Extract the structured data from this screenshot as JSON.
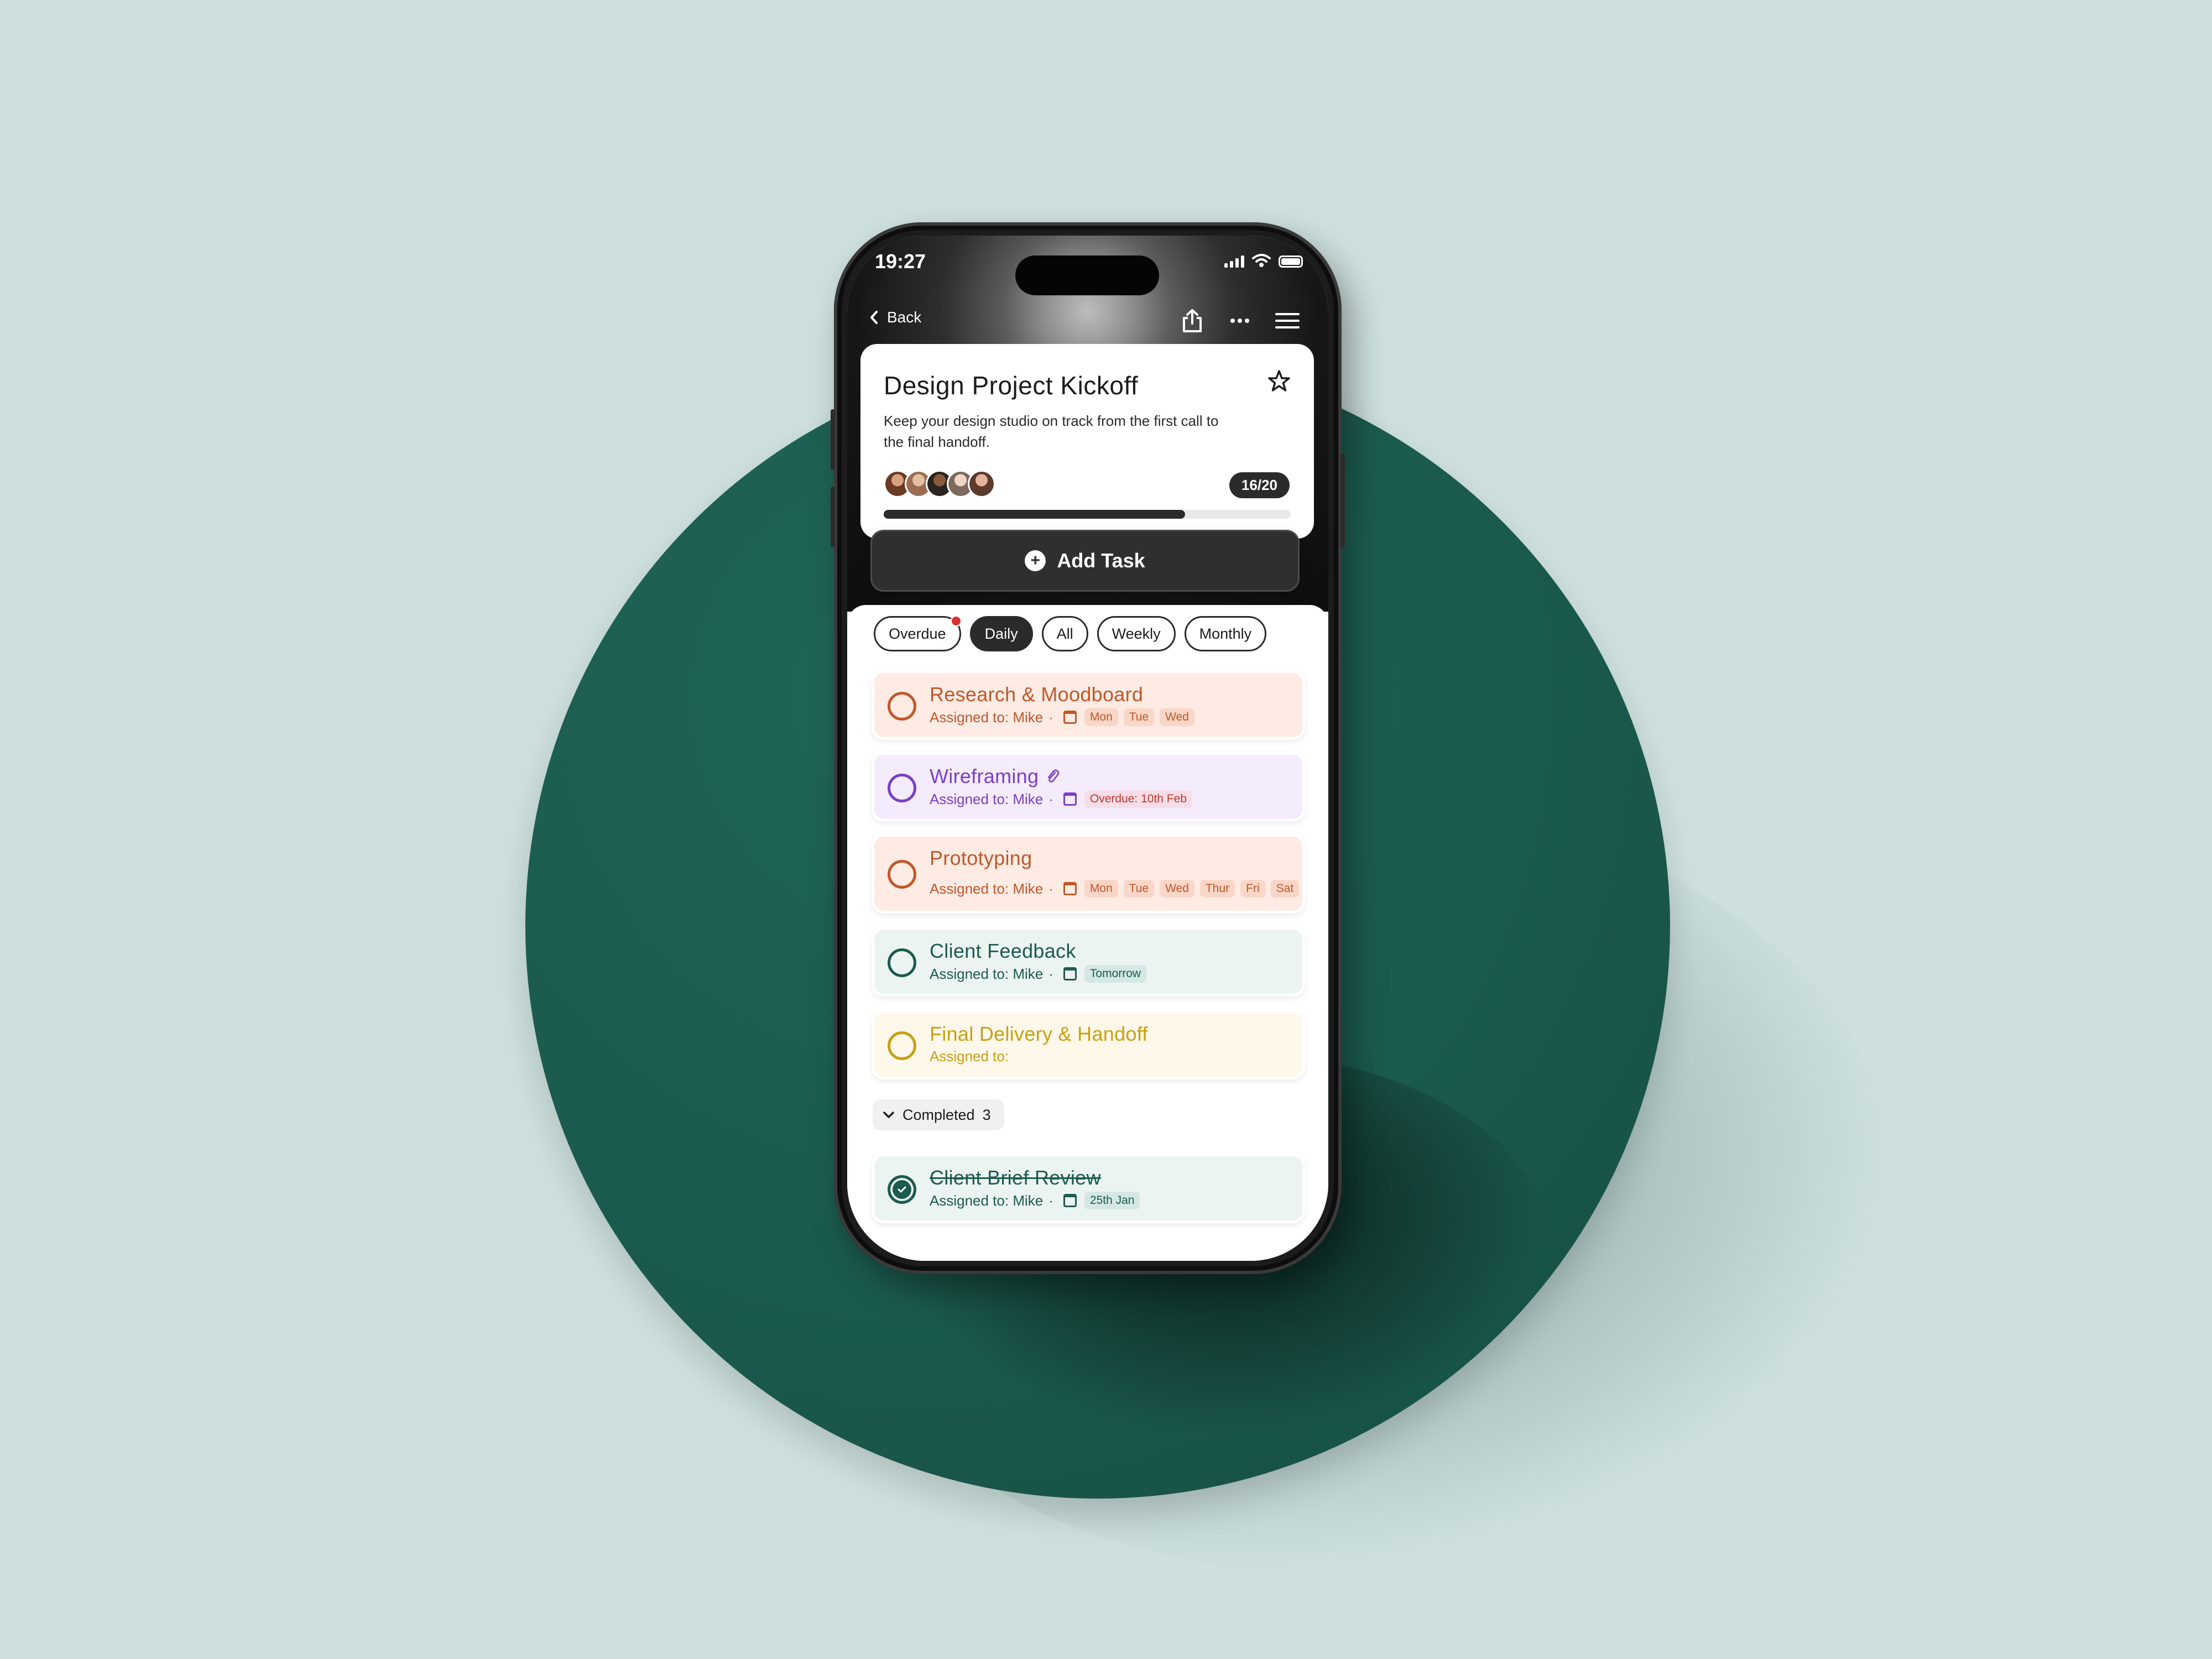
{
  "status": {
    "time": "19:27"
  },
  "nav": {
    "back_label": "Back"
  },
  "project": {
    "title": "Design Project Kickoff",
    "description": "Keep your design studio on track from the first call to the final handoff.",
    "progress_label": "16/20",
    "progress_fraction": 0.74
  },
  "add_task_label": "Add Task",
  "filters": [
    {
      "label": "Overdue",
      "active": false,
      "notify": true
    },
    {
      "label": "Daily",
      "active": true,
      "notify": false
    },
    {
      "label": "All",
      "active": false,
      "notify": false
    },
    {
      "label": "Weekly",
      "active": false,
      "notify": false
    },
    {
      "label": "Monthly",
      "active": false,
      "notify": false
    }
  ],
  "tasks": [
    {
      "title": "Research & Moodboard",
      "assigned": "Assigned to: Mike",
      "tags": [
        "Mon",
        "Tue",
        "Wed"
      ]
    },
    {
      "title": "Wireframing",
      "assigned": "Assigned to: Mike",
      "tags": [
        "Overdue: 10th Feb"
      ]
    },
    {
      "title": "Prototyping",
      "assigned": "Assigned to: Mike",
      "tags": [
        "Mon",
        "Tue",
        "Wed",
        "Thur",
        "Fri",
        "Sat"
      ]
    },
    {
      "title": "Client Feedback",
      "assigned": "Assigned to: Mike",
      "tags": [
        "Tomorrow"
      ]
    },
    {
      "title": "Final Delivery & Handoff",
      "assigned": "Assigned to:",
      "tags": []
    }
  ],
  "completed": {
    "label": "Completed",
    "count": "3",
    "items": [
      {
        "title": "Client Brief Review",
        "assigned": "Assigned to: Mike",
        "tags": [
          "25th Jan"
        ]
      }
    ]
  },
  "colors": {
    "orange": "#c0582a",
    "orange_bg": "#fdebe4",
    "purple": "#7b3fc4",
    "purple_bg": "#f4ecfc",
    "teal": "#1c5b4f",
    "teal_bg": "#ecf4f2",
    "yellow": "#c9a012",
    "yellow_bg": "#fdf8ea",
    "red_tag": "#c0392b"
  }
}
